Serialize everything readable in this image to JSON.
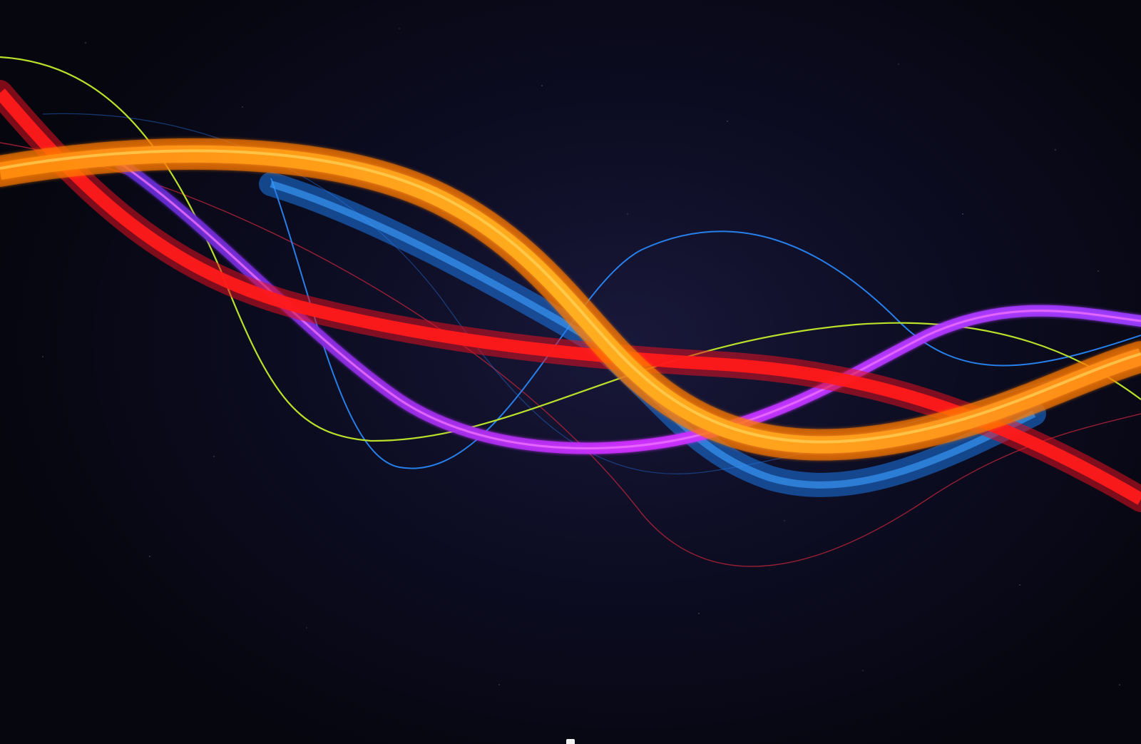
{
  "screen": {
    "kind": "desktop",
    "wallpaper": {
      "description_icon": "abstract-light-waves",
      "background_color": "#0a0a1e",
      "colors": {
        "orange": "#ff9a14",
        "red": "#ff1a1a",
        "blue": "#1e7ef0",
        "purple": "#b832ff",
        "yellow_green": "#b9e02a",
        "thin_red": "#c8283a"
      }
    },
    "dock_indicator_color": "#f2f2f2"
  }
}
